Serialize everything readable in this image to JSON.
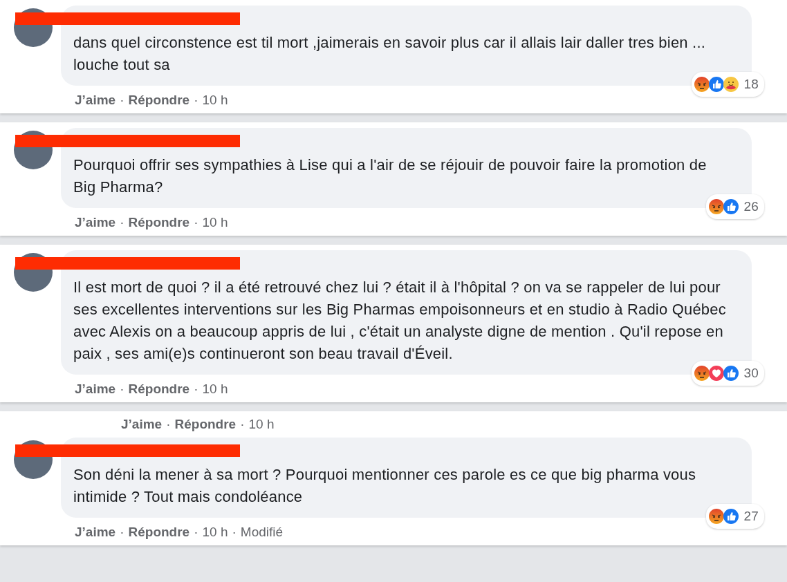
{
  "separator": "·",
  "comments": [
    {
      "text": "dans quel circonstence est til mort ,jaimerais en savoir plus car il allais lair daller tres bien ... louche tout sa",
      "reactions": [
        {
          "kind": "angry"
        },
        {
          "kind": "like"
        },
        {
          "kind": "care"
        }
      ],
      "reaction_count": "18",
      "actions": [
        {
          "text": "J’aime",
          "kind": "link"
        },
        {
          "text": "Répondre",
          "kind": "link"
        },
        {
          "text": "10 h",
          "kind": "time"
        }
      ]
    },
    {
      "text": "Pourquoi offrir ses sympathies à Lise qui a l'air de se réjouir de pouvoir faire la promotion de Big Pharma?",
      "reactions": [
        {
          "kind": "angry"
        },
        {
          "kind": "like"
        }
      ],
      "reaction_count": "26",
      "actions": [
        {
          "text": "J’aime",
          "kind": "link"
        },
        {
          "text": "Répondre",
          "kind": "link"
        },
        {
          "text": "10 h",
          "kind": "time"
        }
      ]
    },
    {
      "text": "Il est mort de quoi ? il a été retrouvé chez lui ? était il à l'hôpital ? on va se rappeler de lui pour ses excellentes interventions sur les Big Pharmas empoisonneurs et en studio à Radio Québec avec Alexis on a beaucoup appris de lui , c'était un analyste digne de mention . Qu'il repose en paix , ses ami(e)s continueront son beau travail d'Éveil.",
      "reactions": [
        {
          "kind": "angry"
        },
        {
          "kind": "love"
        },
        {
          "kind": "like"
        }
      ],
      "reaction_count": "30",
      "actions": [
        {
          "text": "J’aime",
          "kind": "link"
        },
        {
          "text": "Répondre",
          "kind": "link"
        },
        {
          "text": "10 h",
          "kind": "time"
        }
      ]
    },
    {
      "leading_actions": [
        {
          "text": "J’aime",
          "kind": "link"
        },
        {
          "text": "Répondre",
          "kind": "link"
        },
        {
          "text": "10 h",
          "kind": "time"
        }
      ],
      "text": "Son déni la mener à sa mort ? Pourquoi mentionner ces parole es ce que big pharma vous intimide ? Tout mais condoléance",
      "reactions": [
        {
          "kind": "angry"
        },
        {
          "kind": "like"
        }
      ],
      "reaction_count": "27",
      "actions": [
        {
          "text": "J’aime",
          "kind": "link"
        },
        {
          "text": "Répondre",
          "kind": "link"
        },
        {
          "text": "10 h",
          "kind": "time"
        },
        {
          "text": "Modifié",
          "kind": "time"
        }
      ]
    }
  ]
}
